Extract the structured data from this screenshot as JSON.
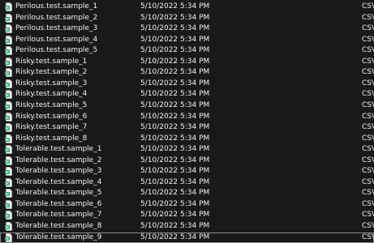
{
  "files": [
    {
      "name": "Perilous.test.sample_1",
      "modified": "5/10/2022 5:34 PM",
      "type": "CSV",
      "icon": "csv-file-icon"
    },
    {
      "name": "Perilous.test.sample_2",
      "modified": "5/10/2022 5:34 PM",
      "type": "CSV",
      "icon": "csv-file-icon"
    },
    {
      "name": "Perilous.test.sample_3",
      "modified": "5/10/2022 5:34 PM",
      "type": "CSV",
      "icon": "csv-file-icon"
    },
    {
      "name": "Perilous.test.sample_4",
      "modified": "5/10/2022 5:34 PM",
      "type": "CSV",
      "icon": "csv-file-icon"
    },
    {
      "name": "Perilous.test.sample_5",
      "modified": "5/10/2022 5:34 PM",
      "type": "CSV",
      "icon": "csv-file-icon"
    },
    {
      "name": "Risky.test.sample_1",
      "modified": "5/10/2022 5:34 PM",
      "type": "CSV",
      "icon": "csv-file-icon"
    },
    {
      "name": "Risky.test.sample_2",
      "modified": "5/10/2022 5:34 PM",
      "type": "CSV",
      "icon": "csv-file-icon"
    },
    {
      "name": "Risky.test.sample_3",
      "modified": "5/10/2022 5:34 PM",
      "type": "CSV",
      "icon": "csv-file-icon"
    },
    {
      "name": "Risky.test.sample_4",
      "modified": "5/10/2022 5:34 PM",
      "type": "CSV",
      "icon": "csv-file-icon"
    },
    {
      "name": "Risky.test.sample_5",
      "modified": "5/10/2022 5:34 PM",
      "type": "CSV",
      "icon": "csv-file-icon"
    },
    {
      "name": "Risky.test.sample_6",
      "modified": "5/10/2022 5:34 PM",
      "type": "CSV",
      "icon": "csv-file-icon"
    },
    {
      "name": "Risky.test.sample_7",
      "modified": "5/10/2022 5:34 PM",
      "type": "CSV",
      "icon": "csv-file-icon"
    },
    {
      "name": "Risky.test.sample_8",
      "modified": "5/10/2022 5:34 PM",
      "type": "CSV",
      "icon": "csv-file-icon"
    },
    {
      "name": "Tolerable.test.sample_1",
      "modified": "5/10/2022 5:34 PM",
      "type": "CSV",
      "icon": "csv-file-icon"
    },
    {
      "name": "Tolerable.test.sample_2",
      "modified": "5/10/2022 5:34 PM",
      "type": "CSV",
      "icon": "csv-file-icon"
    },
    {
      "name": "Tolerable.test.sample_3",
      "modified": "5/10/2022 5:34 PM",
      "type": "CSV",
      "icon": "csv-file-icon"
    },
    {
      "name": "Tolerable.test.sample_4",
      "modified": "5/10/2022 5:34 PM",
      "type": "CSV",
      "icon": "csv-file-icon"
    },
    {
      "name": "Tolerable.test.sample_5",
      "modified": "5/10/2022 5:34 PM",
      "type": "CSV",
      "icon": "csv-file-icon"
    },
    {
      "name": "Tolerable.test.sample_6",
      "modified": "5/10/2022 5:34 PM",
      "type": "CSV",
      "icon": "csv-file-icon"
    },
    {
      "name": "Tolerable.test.sample_7",
      "modified": "5/10/2022 5:34 PM",
      "type": "CSV",
      "icon": "csv-file-icon"
    },
    {
      "name": "Tolerable.test.sample_8",
      "modified": "5/10/2022 5:34 PM",
      "type": "CSV",
      "icon": "csv-file-icon"
    },
    {
      "name": "Tolerable.test.sample_9",
      "modified": "5/10/2022 5:34 PM",
      "type": "CSV",
      "icon": "csv-file-icon",
      "selected": true
    }
  ],
  "colors": {
    "background": "#191919",
    "text": "#f0f0f0",
    "icon_page": "#ffffff",
    "icon_accent": "#21a366",
    "selection_border": "#8a8a8a"
  }
}
